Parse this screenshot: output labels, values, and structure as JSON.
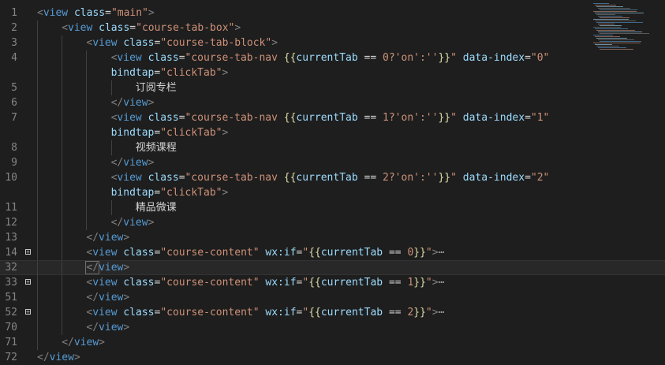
{
  "editor": {
    "lines": [
      {
        "n": "1",
        "indent": 0,
        "fold": false,
        "parts": [
          [
            "punc",
            "<"
          ],
          [
            "tag",
            "view "
          ],
          [
            "attr",
            "class"
          ],
          [
            "txt",
            "="
          ],
          [
            "str",
            "\"main\""
          ],
          [
            "punc",
            ">"
          ]
        ]
      },
      {
        "n": "2",
        "indent": 1,
        "fold": false,
        "parts": [
          [
            "punc",
            "<"
          ],
          [
            "tag",
            "view "
          ],
          [
            "attr",
            "class"
          ],
          [
            "txt",
            "="
          ],
          [
            "str",
            "\"course-tab-box\""
          ],
          [
            "punc",
            ">"
          ]
        ]
      },
      {
        "n": "3",
        "indent": 2,
        "fold": false,
        "parts": [
          [
            "punc",
            "<"
          ],
          [
            "tag",
            "view "
          ],
          [
            "attr",
            "class"
          ],
          [
            "txt",
            "="
          ],
          [
            "str",
            "\"course-tab-block\""
          ],
          [
            "punc",
            ">"
          ]
        ]
      },
      {
        "n": "4",
        "indent": 3,
        "fold": false,
        "parts": [
          [
            "punc",
            "<"
          ],
          [
            "tag",
            "view "
          ],
          [
            "attr",
            "class"
          ],
          [
            "txt",
            "="
          ],
          [
            "str",
            "\"course-tab-nav "
          ],
          [
            "mus",
            "{{"
          ],
          [
            "exprv",
            "currentTab"
          ],
          [
            "txt",
            " == "
          ],
          [
            "str",
            "0?'on':''"
          ],
          [
            "mus",
            "}}"
          ],
          [
            "str",
            "\""
          ],
          [
            "txt",
            " "
          ],
          [
            "attr",
            "data-index"
          ],
          [
            "txt",
            "="
          ],
          [
            "str",
            "\"0\""
          ]
        ]
      },
      {
        "n": "",
        "indent": 3,
        "fold": false,
        "parts": [
          [
            "attr",
            "bindtap"
          ],
          [
            "txt",
            "="
          ],
          [
            "str",
            "\"clickTab\""
          ],
          [
            "punc",
            ">"
          ]
        ]
      },
      {
        "n": "5",
        "indent": 4,
        "fold": false,
        "parts": [
          [
            "txt",
            "订阅专栏"
          ]
        ]
      },
      {
        "n": "6",
        "indent": 3,
        "fold": false,
        "parts": [
          [
            "punc",
            "</"
          ],
          [
            "tag",
            "view"
          ],
          [
            "punc",
            ">"
          ]
        ]
      },
      {
        "n": "7",
        "indent": 3,
        "fold": false,
        "parts": [
          [
            "punc",
            "<"
          ],
          [
            "tag",
            "view "
          ],
          [
            "attr",
            "class"
          ],
          [
            "txt",
            "="
          ],
          [
            "str",
            "\"course-tab-nav "
          ],
          [
            "mus",
            "{{"
          ],
          [
            "exprv",
            "currentTab"
          ],
          [
            "txt",
            " == "
          ],
          [
            "str",
            "1?'on':''"
          ],
          [
            "mus",
            "}}"
          ],
          [
            "str",
            "\""
          ],
          [
            "txt",
            " "
          ],
          [
            "attr",
            "data-index"
          ],
          [
            "txt",
            "="
          ],
          [
            "str",
            "\"1\""
          ]
        ]
      },
      {
        "n": "",
        "indent": 3,
        "fold": false,
        "parts": [
          [
            "attr",
            "bindtap"
          ],
          [
            "txt",
            "="
          ],
          [
            "str",
            "\"clickTab\""
          ],
          [
            "punc",
            ">"
          ]
        ]
      },
      {
        "n": "8",
        "indent": 4,
        "fold": false,
        "parts": [
          [
            "txt",
            "视频课程"
          ]
        ]
      },
      {
        "n": "9",
        "indent": 3,
        "fold": false,
        "parts": [
          [
            "punc",
            "</"
          ],
          [
            "tag",
            "view"
          ],
          [
            "punc",
            ">"
          ]
        ]
      },
      {
        "n": "10",
        "indent": 3,
        "fold": false,
        "parts": [
          [
            "punc",
            "<"
          ],
          [
            "tag",
            "view "
          ],
          [
            "attr",
            "class"
          ],
          [
            "txt",
            "="
          ],
          [
            "str",
            "\"course-tab-nav "
          ],
          [
            "mus",
            "{{"
          ],
          [
            "exprv",
            "currentTab"
          ],
          [
            "txt",
            " == "
          ],
          [
            "str",
            "2?'on':''"
          ],
          [
            "mus",
            "}}"
          ],
          [
            "str",
            "\""
          ],
          [
            "txt",
            " "
          ],
          [
            "attr",
            "data-index"
          ],
          [
            "txt",
            "="
          ],
          [
            "str",
            "\"2\""
          ]
        ]
      },
      {
        "n": "",
        "indent": 3,
        "fold": false,
        "parts": [
          [
            "attr",
            "bindtap"
          ],
          [
            "txt",
            "="
          ],
          [
            "str",
            "\"clickTab\""
          ],
          [
            "punc",
            ">"
          ]
        ]
      },
      {
        "n": "11",
        "indent": 4,
        "fold": false,
        "parts": [
          [
            "txt",
            "精品微课"
          ]
        ]
      },
      {
        "n": "12",
        "indent": 3,
        "fold": false,
        "parts": [
          [
            "punc",
            "</"
          ],
          [
            "tag",
            "view"
          ],
          [
            "punc",
            ">"
          ]
        ]
      },
      {
        "n": "13",
        "indent": 2,
        "fold": false,
        "parts": [
          [
            "punc",
            "</"
          ],
          [
            "tag",
            "view"
          ],
          [
            "punc",
            ">"
          ]
        ]
      },
      {
        "n": "14",
        "indent": 2,
        "fold": true,
        "parts": [
          [
            "punc",
            "<"
          ],
          [
            "tag",
            "view "
          ],
          [
            "attr",
            "class"
          ],
          [
            "txt",
            "="
          ],
          [
            "str",
            "\"course-content\""
          ],
          [
            "txt",
            " "
          ],
          [
            "attr",
            "wx:if"
          ],
          [
            "txt",
            "="
          ],
          [
            "str",
            "\""
          ],
          [
            "mus",
            "{{"
          ],
          [
            "exprv",
            "currentTab"
          ],
          [
            "txt",
            " == "
          ],
          [
            "str",
            "0"
          ],
          [
            "mus",
            "}}"
          ],
          [
            "str",
            "\""
          ],
          [
            "punc",
            ">"
          ],
          [
            "ell",
            "⋯"
          ]
        ]
      },
      {
        "n": "32",
        "indent": 2,
        "fold": false,
        "current": true,
        "parts": [
          [
            "punc",
            "</"
          ],
          [
            "tag",
            "view"
          ],
          [
            "punc",
            ">"
          ]
        ]
      },
      {
        "n": "33",
        "indent": 2,
        "fold": true,
        "parts": [
          [
            "punc",
            "<"
          ],
          [
            "tag",
            "view "
          ],
          [
            "attr",
            "class"
          ],
          [
            "txt",
            "="
          ],
          [
            "str",
            "\"course-content\""
          ],
          [
            "txt",
            " "
          ],
          [
            "attr",
            "wx:if"
          ],
          [
            "txt",
            "="
          ],
          [
            "str",
            "\""
          ],
          [
            "mus",
            "{{"
          ],
          [
            "exprv",
            "currentTab"
          ],
          [
            "txt",
            " == "
          ],
          [
            "str",
            "1"
          ],
          [
            "mus",
            "}}"
          ],
          [
            "str",
            "\""
          ],
          [
            "punc",
            ">"
          ],
          [
            "ell",
            "⋯"
          ]
        ]
      },
      {
        "n": "51",
        "indent": 2,
        "fold": false,
        "parts": [
          [
            "punc",
            "</"
          ],
          [
            "tag",
            "view"
          ],
          [
            "punc",
            ">"
          ]
        ]
      },
      {
        "n": "52",
        "indent": 2,
        "fold": true,
        "parts": [
          [
            "punc",
            "<"
          ],
          [
            "tag",
            "view "
          ],
          [
            "attr",
            "class"
          ],
          [
            "txt",
            "="
          ],
          [
            "str",
            "\"course-content\""
          ],
          [
            "txt",
            " "
          ],
          [
            "attr",
            "wx:if"
          ],
          [
            "txt",
            "="
          ],
          [
            "str",
            "\""
          ],
          [
            "mus",
            "{{"
          ],
          [
            "exprv",
            "currentTab"
          ],
          [
            "txt",
            " == "
          ],
          [
            "str",
            "2"
          ],
          [
            "mus",
            "}}"
          ],
          [
            "str",
            "\""
          ],
          [
            "punc",
            ">"
          ],
          [
            "ell",
            "⋯"
          ]
        ]
      },
      {
        "n": "70",
        "indent": 2,
        "fold": false,
        "parts": [
          [
            "punc",
            "</"
          ],
          [
            "tag",
            "view"
          ],
          [
            "punc",
            ">"
          ]
        ]
      },
      {
        "n": "71",
        "indent": 1,
        "fold": false,
        "parts": [
          [
            "punc",
            "</"
          ],
          [
            "tag",
            "view"
          ],
          [
            "punc",
            ">"
          ]
        ]
      },
      {
        "n": "72",
        "indent": 0,
        "fold": false,
        "parts": [
          [
            "punc",
            "</"
          ],
          [
            "tag",
            "view"
          ],
          [
            "punc",
            ">"
          ]
        ]
      }
    ]
  },
  "colors": {
    "background": "#1e1e1e",
    "tag": "#569cd6",
    "attribute": "#9cdcfe",
    "string": "#ce9178",
    "mustache": "#dcdcaa",
    "line_number": "#858585"
  },
  "icons": {
    "fold": "plus-box-icon"
  }
}
